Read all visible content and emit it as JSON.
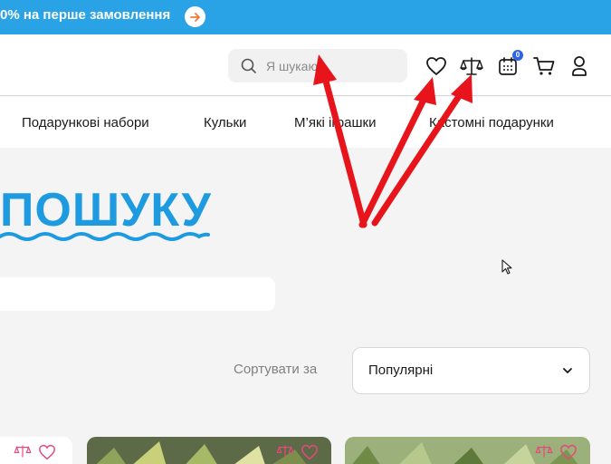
{
  "promo": {
    "text": "0% на перше замовлення",
    "arrow_icon": "arrow-right-icon"
  },
  "header": {
    "search": {
      "placeholder": "Я шукаю",
      "icon": "search-icon"
    },
    "icons": {
      "wishlist": "heart-icon",
      "compare": "scales-icon",
      "calendar": "calendar-icon",
      "calendar_badge": "0",
      "cart": "cart-icon",
      "account": "user-icon"
    }
  },
  "nav": {
    "items": [
      {
        "label": "Подарункові набори"
      },
      {
        "label": "Кульки"
      },
      {
        "label": "М’які іграшки"
      },
      {
        "label": "Кастомні подарунки"
      }
    ]
  },
  "main": {
    "title": "ПОШУКУ",
    "sort": {
      "label": "Сортувати за",
      "value": "Популярні"
    }
  },
  "annotation": {
    "arrow_color": "#e8141c"
  },
  "colors": {
    "brand": "#2aa3e6",
    "title": "#1e9be0",
    "accent": "#f27a37",
    "badge": "#2f64e0"
  }
}
